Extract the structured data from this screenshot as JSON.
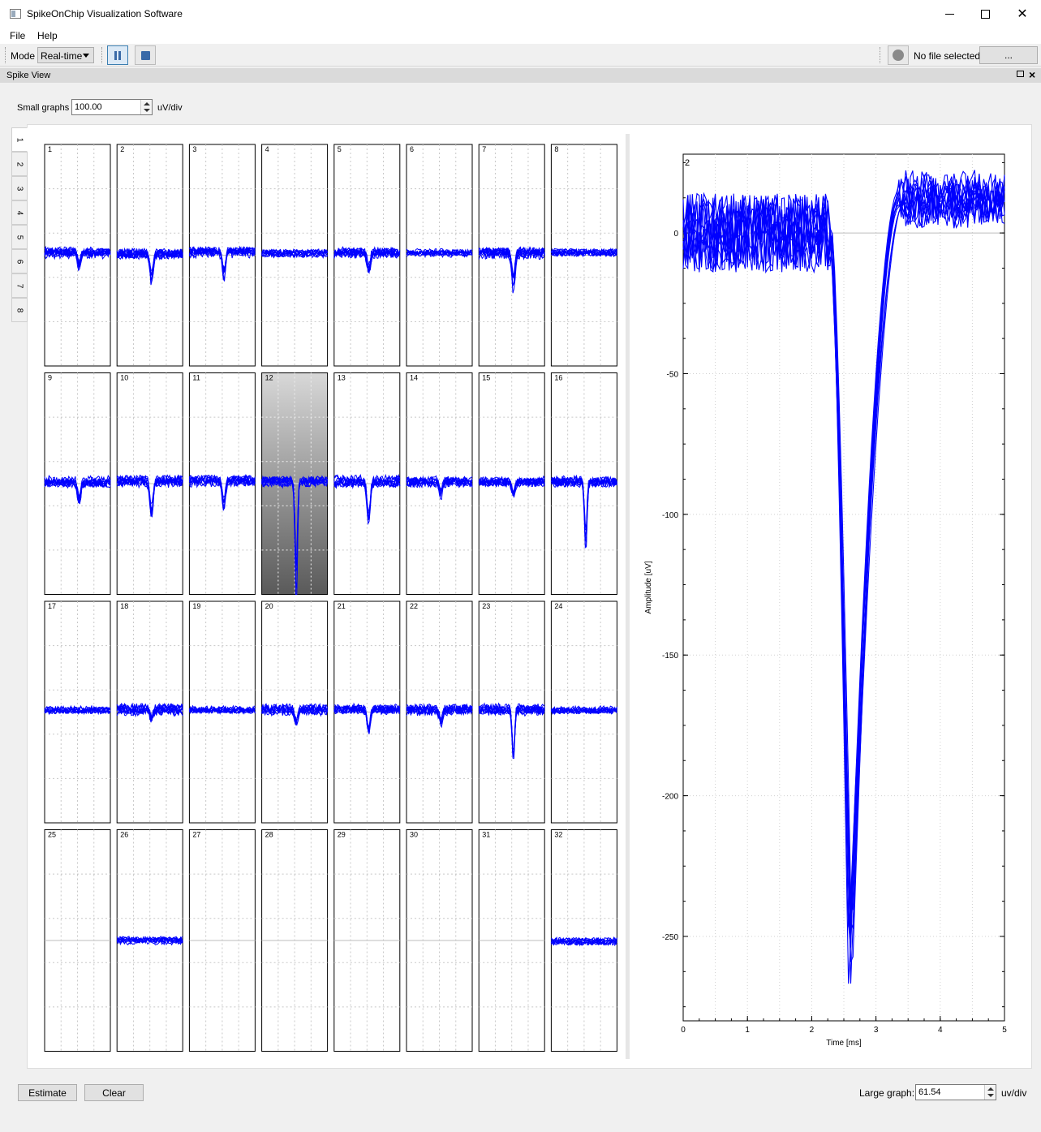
{
  "window": {
    "title": "SpikeOnChip Visualization Software"
  },
  "menu": {
    "file": "File",
    "help": "Help"
  },
  "toolbar": {
    "mode_label": "Mode",
    "mode_value": "Real-time",
    "file_status": "No file selected",
    "browse_label": "..."
  },
  "dock": {
    "title": "Spike View"
  },
  "controls": {
    "small_graphs_label": "Small graphs",
    "small_graphs_value": "100.00",
    "small_graphs_unit": "uV/div",
    "large_graph_label": "Large graph:",
    "large_graph_value": "61.54",
    "large_graph_unit": "uv/div",
    "estimate_label": "Estimate",
    "clear_label": "Clear"
  },
  "tabs": [
    "1",
    "2",
    "3",
    "4",
    "5",
    "6",
    "7",
    "8"
  ],
  "selected_tab": 0,
  "colors": {
    "trace": "#0000ff",
    "selected_gradient_top": "#d8d8d8",
    "selected_gradient_bottom": "#5a5a5a"
  },
  "channels": {
    "labels": [
      "1",
      "2",
      "3",
      "4",
      "5",
      "6",
      "7",
      "8",
      "9",
      "10",
      "11",
      "12",
      "13",
      "14",
      "15",
      "16",
      "17",
      "18",
      "19",
      "20",
      "21",
      "22",
      "23",
      "24",
      "25",
      "26",
      "27",
      "28",
      "29",
      "30",
      "31",
      "32"
    ],
    "selected": "12",
    "active": [
      true,
      true,
      true,
      true,
      true,
      true,
      true,
      true,
      true,
      true,
      true,
      true,
      true,
      true,
      true,
      true,
      true,
      true,
      true,
      true,
      true,
      true,
      true,
      true,
      false,
      true,
      false,
      false,
      false,
      false,
      false,
      true
    ],
    "spike_amplitude_uv": [
      -30,
      -60,
      -60,
      0,
      -45,
      0,
      -75,
      0,
      -45,
      -75,
      -60,
      -270,
      -90,
      -30,
      -30,
      -150,
      0,
      -20,
      0,
      -30,
      -60,
      -30,
      -120,
      0,
      0,
      0,
      0,
      0,
      0,
      0,
      0,
      0
    ]
  },
  "chart_data": {
    "type": "line",
    "channel_label": "2",
    "xlabel": "Time [ms]",
    "ylabel": "Amplitude [uV]",
    "xlim": [
      0,
      5
    ],
    "ylim": [
      -280,
      28
    ],
    "xticks": [
      "0",
      "1",
      "2",
      "3",
      "4",
      "5"
    ],
    "yticks": [
      {
        "value": 0,
        "label": "0"
      },
      {
        "value": -50,
        "label": "-50"
      },
      {
        "value": -100,
        "label": "-100"
      },
      {
        "value": -150,
        "label": "-150"
      },
      {
        "value": -200,
        "label": "-200"
      },
      {
        "value": -250,
        "label": "-250"
      }
    ],
    "series_count": 12,
    "baseline_uv": 0,
    "spike_start_ms": 2.3,
    "spike_peak_ms": 2.6,
    "spike_peak_uv": -275,
    "recovery_ms": 3.4,
    "recovery_level_uv": 12
  }
}
